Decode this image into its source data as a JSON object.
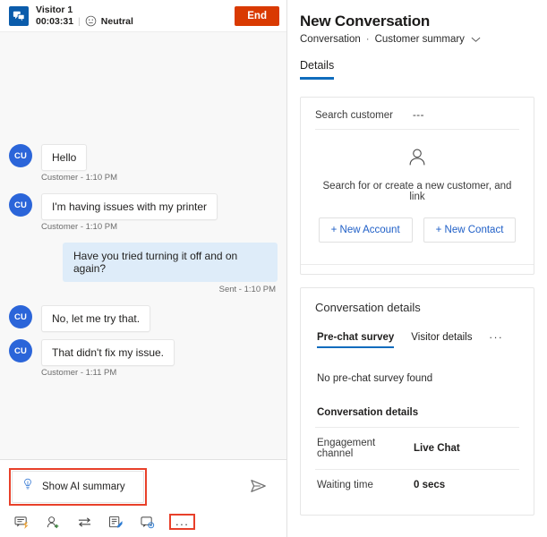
{
  "chat": {
    "header": {
      "visitor_icon": "chat-bubbles-icon",
      "visitor_name": "Visitor 1",
      "duration": "00:03:31",
      "sentiment_icon": "neutral-face-icon",
      "sentiment_label": "Neutral",
      "end_label": "End"
    },
    "messages": [
      {
        "direction": "in",
        "avatar": "CU",
        "text": "Hello",
        "stamp": "Customer - 1:10 PM"
      },
      {
        "direction": "in",
        "avatar": "CU",
        "text": "I'm having issues with my printer",
        "stamp": "Customer - 1:10 PM"
      },
      {
        "direction": "out",
        "text": "Have you tried turning it off and on again?",
        "stamp": "Sent - 1:10 PM"
      },
      {
        "direction": "in",
        "avatar": "CU",
        "text": "No, let me try that.",
        "stamp": ""
      },
      {
        "direction": "in",
        "avatar": "CU",
        "text": "That didn't fix my issue.",
        "stamp": "Customer - 1:11 PM"
      }
    ],
    "compose": {
      "ai_summary_icon": "lightbulb-icon",
      "ai_summary_label": "Show AI summary",
      "send_icon": "send-icon",
      "highlight_color": "#e8402a"
    },
    "tools": [
      {
        "icon": "quick-replies-icon"
      },
      {
        "icon": "add-agent-icon"
      },
      {
        "icon": "transfer-icon"
      },
      {
        "icon": "notes-icon"
      },
      {
        "icon": "consult-icon"
      }
    ],
    "more_tools": {
      "icon": "ellipsis-icon",
      "label": "..."
    }
  },
  "details": {
    "title": "New Conversation",
    "breadcrumb": {
      "root": "Conversation",
      "separator": "·",
      "current": "Customer summary",
      "chevron_icon": "chevron-down-icon"
    },
    "tabs": [
      {
        "label": "Details",
        "active": true
      }
    ],
    "customer_card": {
      "search_label": "Search customer",
      "search_value": "---",
      "empty_icon": "person-icon",
      "empty_caption": "Search for or create a new customer, and link",
      "buttons": [
        {
          "label": "+ New Account"
        },
        {
          "label": "+ New Contact"
        }
      ]
    },
    "conversation_card": {
      "title": "Conversation details",
      "sub_tabs": [
        {
          "label": "Pre-chat survey",
          "active": true
        },
        {
          "label": "Visitor details",
          "active": false
        }
      ],
      "overflow_label": "...",
      "empty_note": "No pre-chat survey found",
      "section_head": "Conversation details",
      "fields": [
        {
          "key": "Engagement channel",
          "value": "Live Chat"
        },
        {
          "key": "Waiting time",
          "value": "0 secs"
        }
      ]
    }
  },
  "colors": {
    "accent": "#0f6cbd",
    "danger": "#d93a02",
    "highlight": "#e8402a",
    "avatar": "#2b65d9",
    "agent_bubble": "#deecf9"
  }
}
